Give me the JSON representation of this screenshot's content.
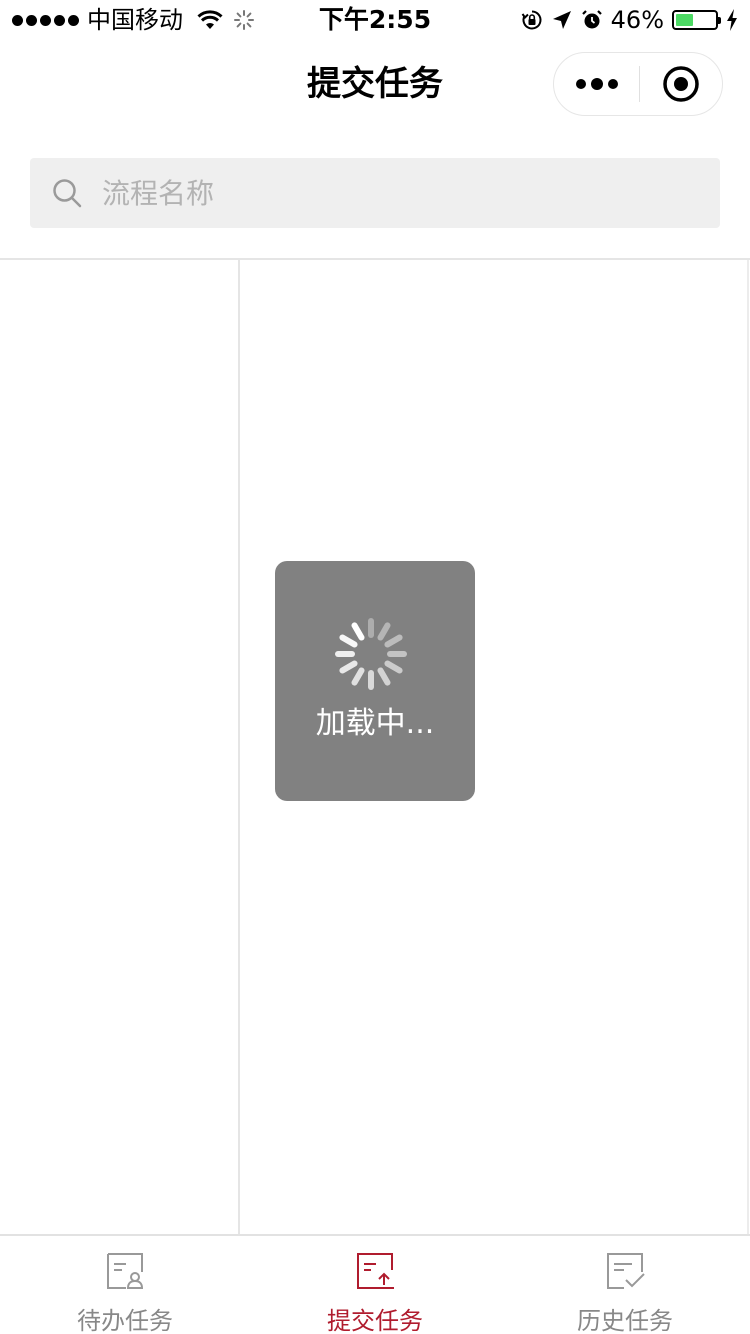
{
  "status_bar": {
    "carrier": "中国移动",
    "time": "下午2:55",
    "battery_percent": "46%",
    "battery_level": 0.46,
    "icons": [
      "signal-dots-icon",
      "wifi-icon",
      "activity-spinner-icon",
      "orientation-lock-icon",
      "location-arrow-icon",
      "alarm-icon",
      "battery-icon",
      "charging-bolt-icon"
    ]
  },
  "nav": {
    "title": "提交任务",
    "capsule_icons": [
      "more-dots-icon",
      "close-target-icon"
    ]
  },
  "search": {
    "placeholder": "流程名称",
    "value": ""
  },
  "loading": {
    "text": "加载中..."
  },
  "tabbar": {
    "tabs": [
      {
        "label": "待办任务",
        "icon": "todo-task-icon",
        "active": false
      },
      {
        "label": "提交任务",
        "icon": "submit-task-icon",
        "active": true
      },
      {
        "label": "历史任务",
        "icon": "history-task-icon",
        "active": false
      }
    ]
  },
  "colors": {
    "accent": "#b01c2e",
    "inactive": "#888888",
    "search_bg": "#efefef",
    "battery_fill": "#4cd964",
    "toast_bg": "#6e6e6e"
  }
}
